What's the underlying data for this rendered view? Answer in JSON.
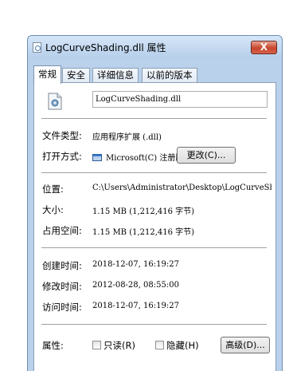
{
  "window": {
    "title": "LogCurveShading.dll 属性",
    "close_label": "X"
  },
  "tabs": [
    {
      "label": "常规",
      "active": true
    },
    {
      "label": "安全",
      "active": false
    },
    {
      "label": "详细信息",
      "active": false
    },
    {
      "label": "以前的版本",
      "active": false
    }
  ],
  "file": {
    "name": "LogCurveShading.dll"
  },
  "general": {
    "type_label": "文件类型:",
    "type_value": "应用程序扩展 (.dll)",
    "open_with_label": "打开方式:",
    "open_with_value": "Microsoft(C) 注册服",
    "change_button": "更改(C)...",
    "location_label": "位置:",
    "location_value": "C:\\Users\\Administrator\\Desktop\\LogCurveSh",
    "size_label": "大小:",
    "size_value": "1.15 MB (1,212,416 字节)",
    "size_on_disk_label": "占用空间:",
    "size_on_disk_value": "1.15 MB (1,212,416 字节)",
    "created_label": "创建时间:",
    "created_value": "2018-12-07, 16:19:27",
    "modified_label": "修改时间:",
    "modified_value": "2012-08-28, 08:55:00",
    "accessed_label": "访问时间:",
    "accessed_value": "2018-12-07, 16:19:27",
    "attributes_label": "属性:",
    "readonly_label": "只读(R)",
    "hidden_label": "隐藏(H)",
    "advanced_button": "高级(D)..."
  },
  "icons": {
    "title": "dll-file-icon",
    "file": "dll-settings-file-icon",
    "app": "registry-app-icon"
  },
  "colors": {
    "frame": "#b9d1ea",
    "close": "#c8452c"
  }
}
